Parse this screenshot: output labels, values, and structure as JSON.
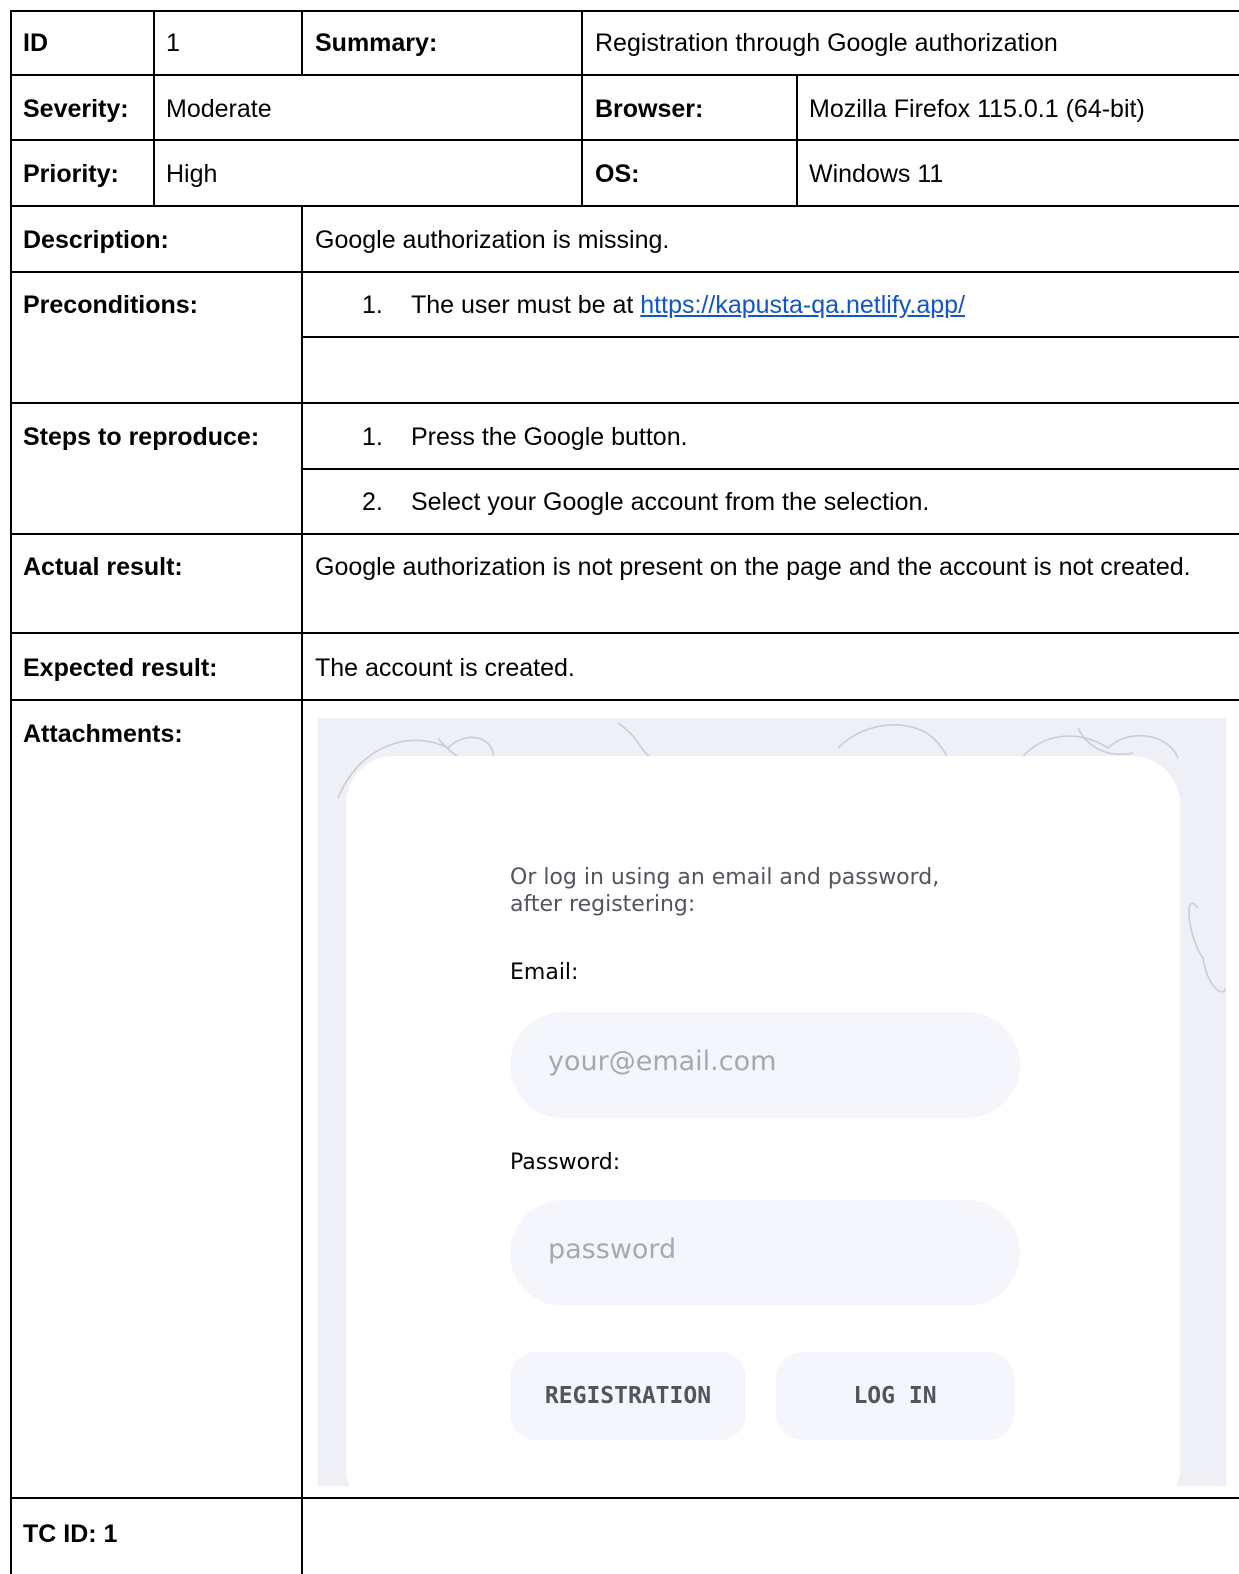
{
  "row_id": {
    "id_label": "ID",
    "id_value": "1",
    "summary_label": "Summary:",
    "summary_value": "Registration through Google authorization"
  },
  "row_severity": {
    "label": "Severity:",
    "value": "Moderate",
    "browser_label": "Browser:",
    "browser_value": "Mozilla Firefox 115.0.1 (64-bit)"
  },
  "row_priority": {
    "label": "Priority:",
    "value": "High",
    "os_label": "OS:",
    "os_value": "Windows 11"
  },
  "description": {
    "label": "Description:",
    "value": "Google authorization is missing."
  },
  "preconditions": {
    "label": "Preconditions:",
    "items": [
      {
        "num": "1.",
        "text": "The user must be at ",
        "link": "https://kapusta-qa.netlify.app/"
      }
    ]
  },
  "steps": {
    "label": "Steps to reproduce:",
    "items": [
      {
        "num": "1.",
        "text": "Press the Google button."
      },
      {
        "num": "2.",
        "text": "Select your Google account from the selection."
      }
    ]
  },
  "actual": {
    "label": "Actual result:",
    "value": "Google authorization is not present on the page and the account is not created."
  },
  "expected": {
    "label": "Expected result:",
    "value": "The account is created."
  },
  "attachments": {
    "label": "Attachments:",
    "screenshot": {
      "intro": [
        "Or log in using an email and password,",
        "after registering:"
      ],
      "email_label": "Email:",
      "email_placeholder": "your@email.com",
      "password_label": "Password:",
      "password_placeholder": "password",
      "registration_button": "REGISTRATION",
      "login_button": "LOG IN"
    }
  },
  "tc": {
    "label": "TC ID: 1"
  }
}
